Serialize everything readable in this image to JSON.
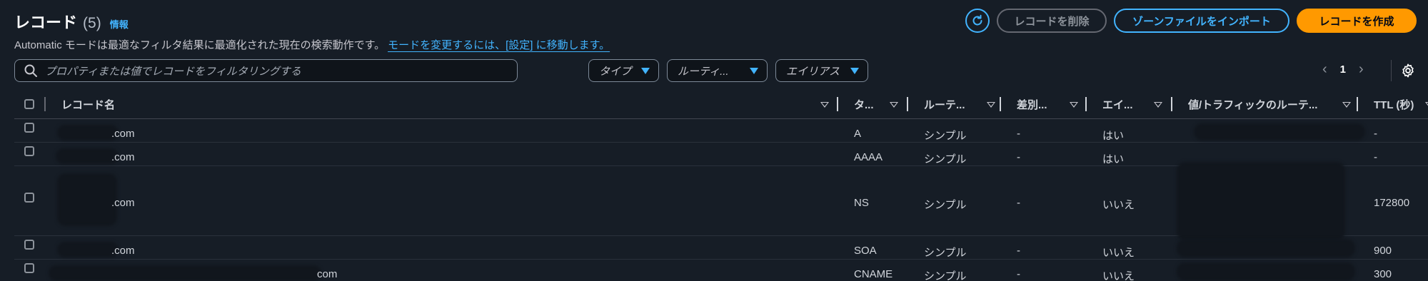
{
  "header": {
    "title": "レコード",
    "count": "(5)",
    "info_link": "情報"
  },
  "description": {
    "text": "Automatic モードは最適なフィルタ結果に最適化された現在の検索動作です。",
    "link": "モードを変更するには、[設定] に移動します。"
  },
  "actions": {
    "refresh_icon": "refresh-icon",
    "delete_label": "レコードを削除",
    "import_label": "ゾーンファイルをインポート",
    "create_label": "レコードを作成"
  },
  "search": {
    "placeholder": "プロパティまたは値でレコードをフィルタリングする",
    "icon": "search-icon"
  },
  "filters": {
    "type_label": "タイプ",
    "routing_label": "ルーティ...",
    "alias_label": "エイリアス"
  },
  "pagination": {
    "prev": "‹",
    "page": "1",
    "next": "›"
  },
  "table": {
    "columns": {
      "name": "レコード名",
      "type": "タ...",
      "routing": "ルーテ...",
      "differentiator": "差別...",
      "alias": "エイ...",
      "value": "値/トラフィックのルーテ...",
      "ttl": "TTL (秒)"
    },
    "rows": [
      {
        "name": ".com",
        "type": "A",
        "routing": "シンプル",
        "differentiator": "-",
        "alias": "はい",
        "ttl": "-"
      },
      {
        "name": ".com",
        "type": "AAAA",
        "routing": "シンプル",
        "differentiator": "-",
        "alias": "はい",
        "ttl": "-"
      },
      {
        "name": ".com",
        "type": "NS",
        "routing": "シンプル",
        "differentiator": "-",
        "alias": "いいえ",
        "ttl": "172800"
      },
      {
        "name": ".com",
        "type": "SOA",
        "routing": "シンプル",
        "differentiator": "-",
        "alias": "いいえ",
        "ttl": "900"
      },
      {
        "name": "com",
        "type": "CNAME",
        "routing": "シンプル",
        "differentiator": "-",
        "alias": "いいえ",
        "ttl": "300"
      }
    ]
  },
  "colors": {
    "background": "#161d26",
    "accent": "#42b4ff",
    "primary": "#ff9900"
  }
}
